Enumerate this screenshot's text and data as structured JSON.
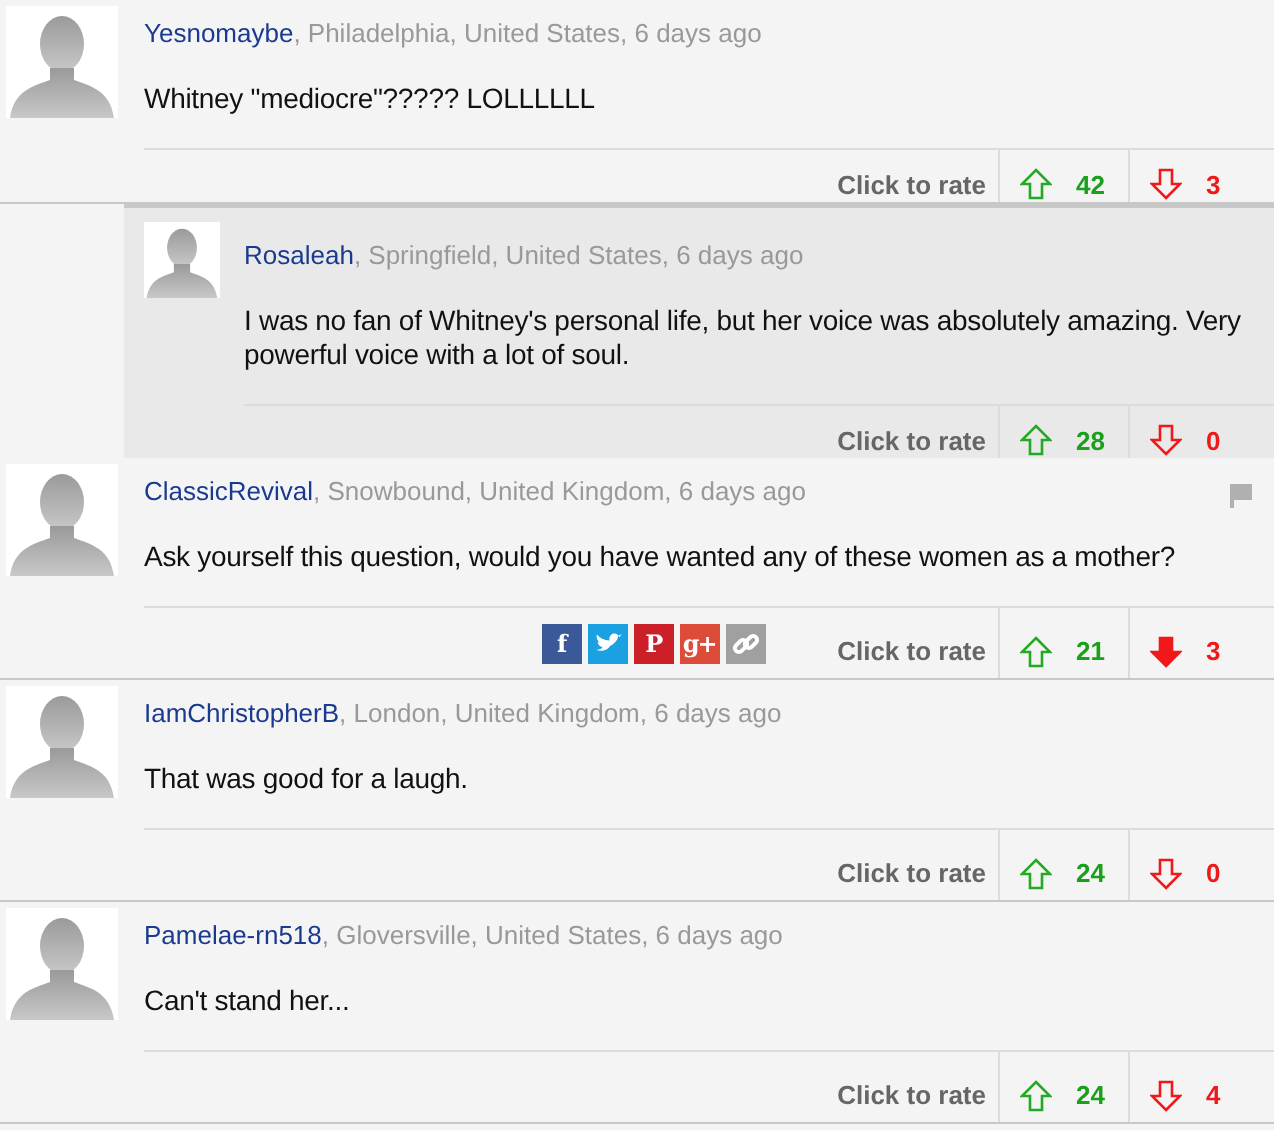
{
  "comments": [
    {
      "author": "Yesnomaybe",
      "meta": ", Philadelphia, United States, 6 days ago",
      "text": "Whitney \"mediocre\"????? LOLLLLLL",
      "rate_label": "Click to rate",
      "up_count": "42",
      "down_count": "3",
      "up_voted": false,
      "down_voted": false,
      "flag": false,
      "children": [
        {
          "author": "Rosaleah",
          "meta": ", Springfield, United States, 6 days ago",
          "text": "I was no fan of Whitney's personal life, but her voice was absolutely amazing. Very powerful voice with a lot of soul.",
          "rate_label": "Click to rate",
          "up_count": "28",
          "down_count": "0",
          "up_voted": false,
          "down_voted": false,
          "flag": false
        }
      ]
    },
    {
      "author": "ClassicRevival",
      "meta": ", Snowbound, United Kingdom, 6 days ago",
      "text": "Ask yourself this question, would you have wanted any of these women as a mother?",
      "rate_label": "Click to rate",
      "up_count": "21",
      "down_count": "3",
      "up_voted": false,
      "down_voted": true,
      "flag": true,
      "share_buttons": [
        {
          "kind": "letter",
          "label": "f",
          "color": "#3b5998"
        },
        {
          "kind": "bird",
          "color": "#1ba1e2"
        },
        {
          "kind": "letter",
          "label": "P",
          "color": "#cb2027"
        },
        {
          "kind": "letter",
          "label": "g+",
          "color": "#dd4b39"
        },
        {
          "kind": "chain",
          "color": "#a0a0a0"
        }
      ]
    },
    {
      "author": "IamChristopherB",
      "meta": ", London, United Kingdom, 6 days ago",
      "text": "That was good for a laugh.",
      "rate_label": "Click to rate",
      "up_count": "24",
      "down_count": "0",
      "up_voted": false,
      "down_voted": false,
      "flag": false
    },
    {
      "author": "Pamelae-rn518",
      "meta": ", Gloversville, United States, 6 days ago",
      "text": "Can't stand her...",
      "rate_label": "Click to rate",
      "up_count": "24",
      "down_count": "4",
      "up_voted": false,
      "down_voted": false,
      "flag": false
    }
  ]
}
